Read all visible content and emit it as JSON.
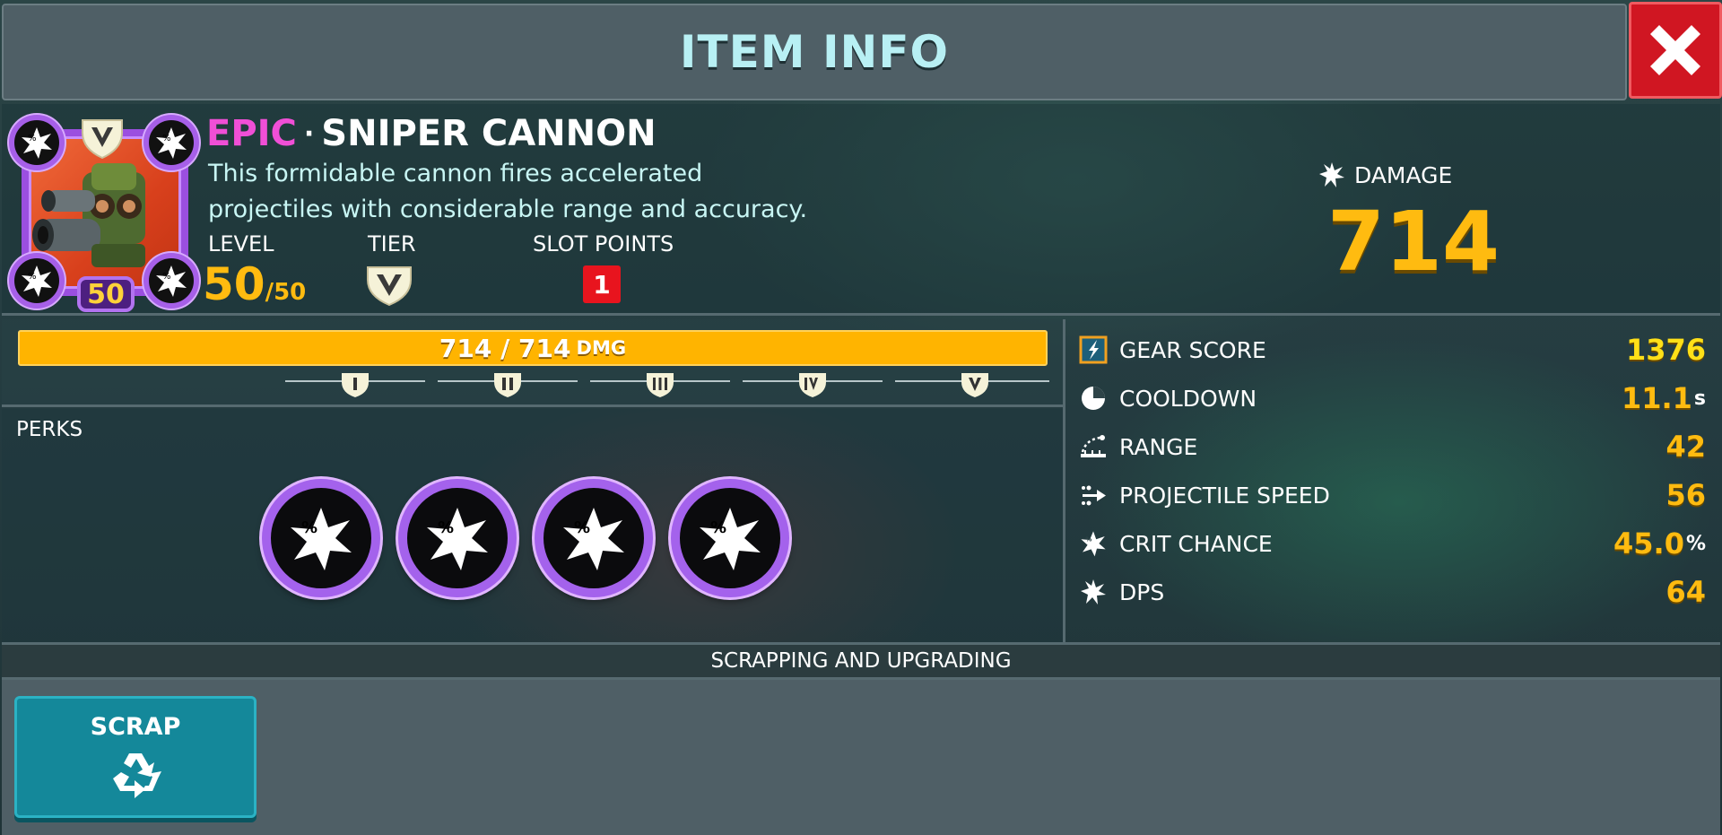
{
  "title": "ITEM INFO",
  "item": {
    "rarity": "EPIC",
    "separator": "·",
    "name": "SNIPER CANNON",
    "description_line1": "This formidable cannon fires accelerated",
    "description_line2": "projectiles with considerable range and accuracy.",
    "level_label": "LEVEL",
    "level_current": "50",
    "level_max": "/50",
    "level_badge": "50",
    "tier_label": "TIER",
    "tier_value": "V",
    "slot_points_label": "SLOT POINTS",
    "slot_points": "1",
    "damage_label": "DAMAGE",
    "damage_value": "714"
  },
  "progress": {
    "text": "714 / 714",
    "unit": "DMG",
    "fill_fraction": 1.0,
    "tiers": [
      "I",
      "II",
      "III",
      "IV",
      "V"
    ]
  },
  "perks": {
    "label": "PERKS",
    "items": [
      "crit-perk-icon",
      "crit-perk-icon",
      "crit-perk-icon",
      "crit-perk-icon"
    ]
  },
  "stats": [
    {
      "name": "GEAR SCORE",
      "value": "1376",
      "suffix": "",
      "icon": "gear-score-icon"
    },
    {
      "name": "COOLDOWN",
      "value": "11.1",
      "suffix": "s",
      "icon": "cooldown-icon"
    },
    {
      "name": "RANGE",
      "value": "42",
      "suffix": "",
      "icon": "range-icon"
    },
    {
      "name": "PROJECTILE SPEED",
      "value": "56",
      "suffix": "",
      "icon": "projectile-speed-icon"
    },
    {
      "name": "CRIT CHANCE",
      "value": "45.0",
      "suffix": "%",
      "icon": "crit-chance-icon"
    },
    {
      "name": "DPS",
      "value": "64",
      "suffix": "",
      "icon": "dps-icon"
    }
  ],
  "footer": {
    "section_title": "SCRAPPING AND UPGRADING",
    "scrap_label": "SCRAP"
  },
  "colors": {
    "rarity": "#f04fd6",
    "value_gold": "#ffbb10",
    "close_red": "#d01622",
    "scrap_teal": "#14889a",
    "perk_purple": "#a462ec"
  }
}
